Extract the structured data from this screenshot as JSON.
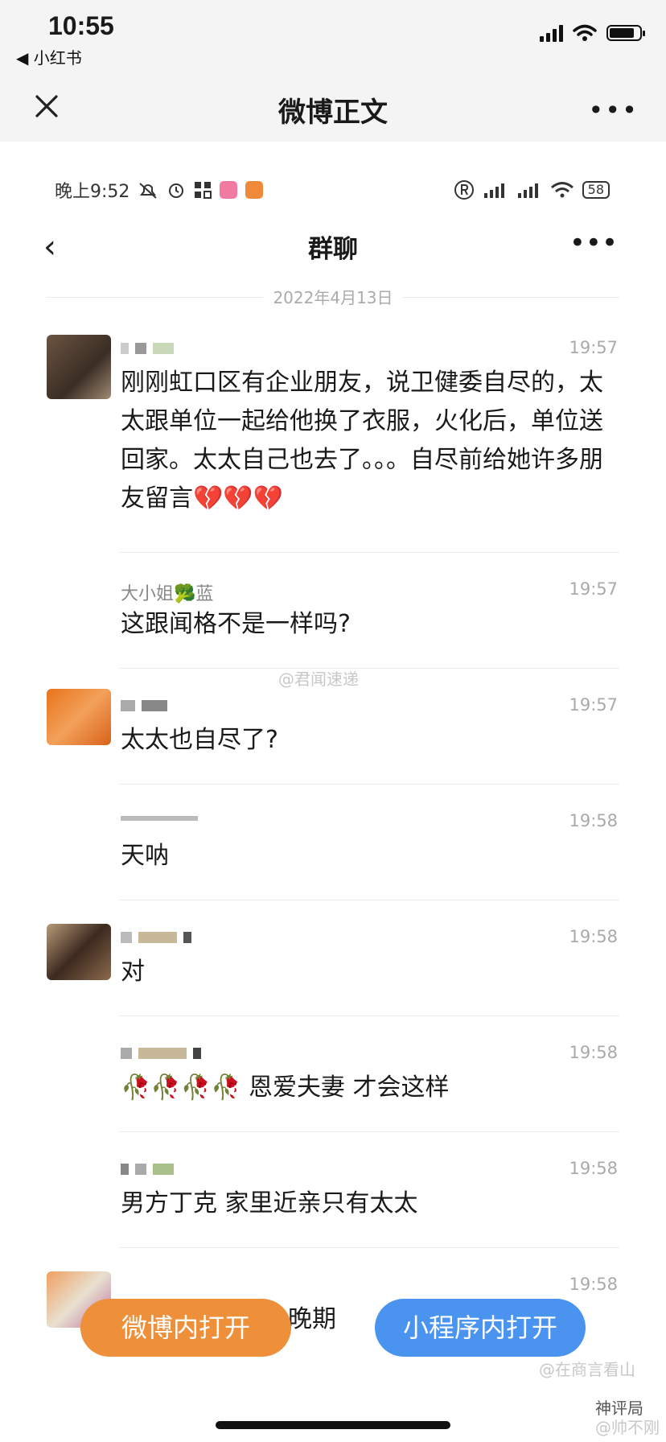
{
  "os_status": {
    "time": "10:55",
    "back_app": "◀ 小红书"
  },
  "nav": {
    "title": "微博正文",
    "more": "•••"
  },
  "inner_status": {
    "time": "晚上9:52",
    "battery": "58"
  },
  "chat": {
    "title": "群聊",
    "date": "2022年4月13日"
  },
  "messages": [
    {
      "sender": "",
      "time": "19:57",
      "text": "刚刚虹口区有企业朋友，说卫健委自尽的，太太跟单位一起给他换了衣服，火化后，单位送回家。太太自己也去了。。。自尽前给她许多朋友留言💔💔💔"
    },
    {
      "sender": "大小姐🥦蓝",
      "time": "19:57",
      "text": "这跟闻格不是一样吗?"
    },
    {
      "sender": "",
      "time": "19:57",
      "text": "太太也自尽了?"
    },
    {
      "sender": "",
      "time": "19:58",
      "text": "天呐"
    },
    {
      "sender": "",
      "time": "19:58",
      "text": "对"
    },
    {
      "sender": "",
      "time": "19:58",
      "text": "🥀🥀🥀🥀 恩爱夫妻 才会这样"
    },
    {
      "sender": "",
      "time": "19:58",
      "text": "男方丁克 家里近亲只有太太"
    },
    {
      "sender": "",
      "time": "19:58",
      "text": "晚期"
    }
  ],
  "watermarks": [
    "@君闻速递",
    "@在商言看山",
    "神评局",
    "@帅不刚"
  ],
  "buttons": {
    "weibo_open": "微博内打开",
    "miniprogram_open": "小程序内打开"
  },
  "colors": {
    "orange": "#ee8f3a",
    "blue": "#4a93ef"
  }
}
